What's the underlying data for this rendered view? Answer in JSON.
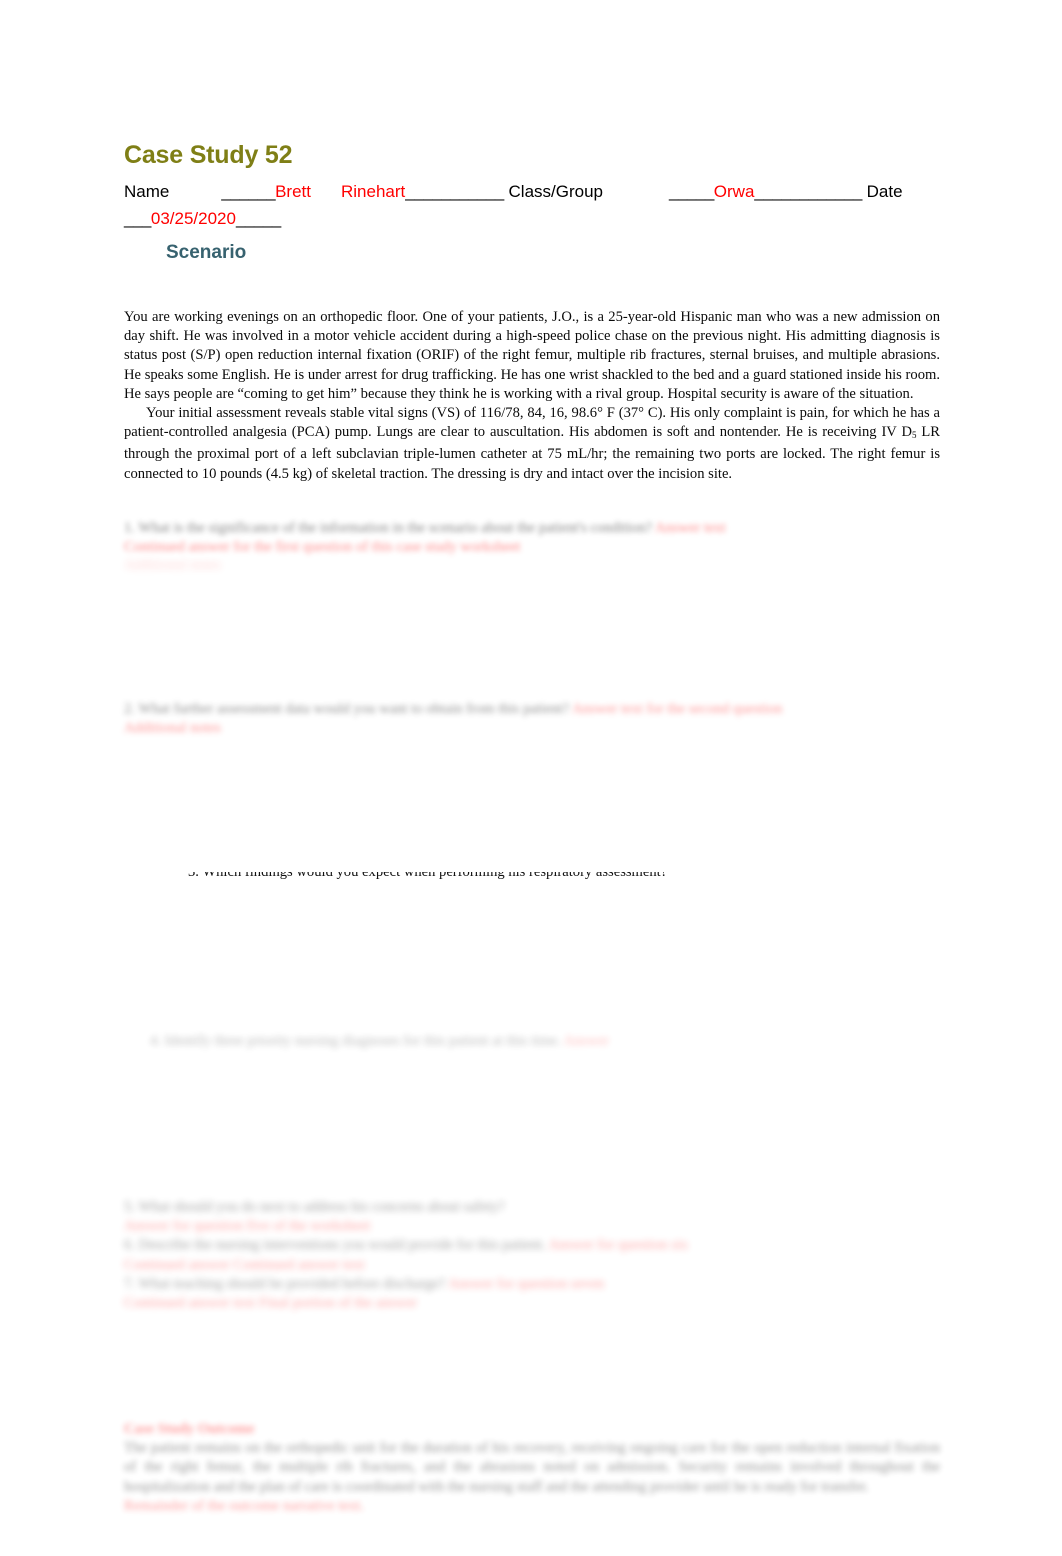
{
  "document": {
    "title": "Case Study 52",
    "title_color": "#7f7f16"
  },
  "header": {
    "name_label": "Name",
    "name_blank_1": "______",
    "student_first": "Brett",
    "student_last": "Rinehart",
    "name_blank_2": "___________",
    "class_label": "Class/Group",
    "class_blank_1": "_____",
    "class_value": "Orwa",
    "class_blank_2": "____________",
    "date_label": "Date",
    "date_blank_1": "___",
    "date_value": "03/25/2020",
    "date_blank_2": "_____",
    "entry_color": "#ff0000"
  },
  "scenario": {
    "heading": "Scenario",
    "heading_color": "#37626f",
    "paragraph_1": "You are working evenings on an orthopedic floor. One of your patients, J.O., is a 25-year-old Hispanic man who was a new admission on day shift. He was involved in a motor vehicle accident during a high-speed police chase on the previous night. His admitting diagnosis is status post (S/P) open reduction internal fixation (ORIF) of the right femur, multiple rib fractures, sternal bruises, and multiple abrasions. He speaks some English. He is under arrest for drug trafficking. He has one wrist shackled to the bed and a guard stationed inside his room. He says people are “coming to get him” because they think he is working with a rival group. Hospital security is aware of the situation.",
    "paragraph_2_a": "Your initial assessment reveals stable vital signs (VS) of 116/78, 84, 16, 98.6° F (37° C). His only complaint is pain, for which he has a patient-controlled analgesia (PCA) pump. Lungs are clear to auscultation. His abdomen is soft and nontender. He is receiving IV D",
    "paragraph_2_sub": "5",
    "paragraph_2_b": " LR through the proximal port of a left subclavian triple-lumen catheter at 75 mL/hr; the remaining two ports are locked. The right femur is connected to 10 pounds (4.5 kg) of skeletal traction. The dressing is dry and intact over the incision site."
  },
  "questions": {
    "q1": {
      "number": "1.",
      "text": "What is the significance of the information in the scenario about the patient's condition?",
      "answer": "Answer text",
      "answer_2": "Continued answer for the first question of this case study worksheet",
      "answer_3": "Additional notes"
    },
    "q2": {
      "number": "2.",
      "text": "What further assessment data would you want to obtain from this patient?",
      "answer": "Answer text for the second question",
      "answer_2": "Additional notes"
    },
    "q3": {
      "number": "3.",
      "text": "Which findings would you expect when performing his respiratory assessment?"
    },
    "q4": {
      "number": "4.",
      "text": "Identify three priority nursing diagnoses for this patient at this time.",
      "answer": "Answer"
    },
    "q5": {
      "number": "5.",
      "text": "What should you do next to address his concerns about safety?",
      "answer": "Answer for question five of the worksheet",
      "answer_2": "Continued answer text",
      "answer_3": "Final portion of the answer"
    },
    "q6": {
      "number": "6.",
      "text": "Describe the nursing interventions you would provide for this patient.",
      "answer": "Answer for question six",
      "answer_2": "Continued answer"
    },
    "q7": {
      "number": "7.",
      "text": "What teaching should be provided before discharge?",
      "answer": "Answer for question seven",
      "answer_2": "Continued answer text"
    }
  },
  "case_study_section": {
    "heading": "Case Study Outcome",
    "body": "The patient remains on the orthopedic unit for the duration of his recovery, receiving ongoing care for the open reduction internal fixation of the right femur, the multiple rib fractures, and the abrasions noted on admission. Security remains involved throughout the hospitalization and the plan of care is coordinated with the nursing staff and the attending provider until he is ready for transfer.",
    "body_red_tail": "Remainder of the outcome narrative text."
  }
}
